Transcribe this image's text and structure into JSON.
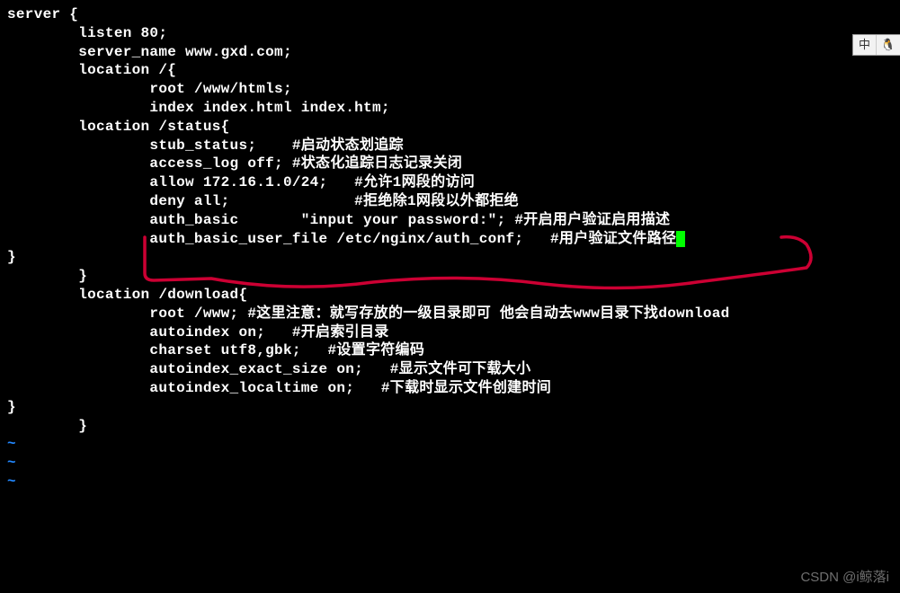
{
  "code": {
    "l0": "server {",
    "l1": "        listen 80;",
    "l2": "        server_name www.gxd.com;",
    "l3": "",
    "l4": "        location /{",
    "l5": "                root /www/htmls;",
    "l6": "                index index.html index.htm;",
    "l7": "        location /status{",
    "l8": "                stub_status;    #启动状态划追踪",
    "l9": "                access_log off; #状态化追踪日志记录关闭",
    "l10": "                allow 172.16.1.0/24;   #允许1网段的访问",
    "l11": "                deny all;              #拒绝除1网段以外都拒绝",
    "l12": "                auth_basic       \"input your password:\"; #开启用户验证启用描述",
    "l13": "                auth_basic_user_file /etc/nginx/auth_conf;   #用户验证文件路径",
    "l14": "}",
    "l15": "        }",
    "l16": "        location /download{",
    "l17": "",
    "l18": "                root /www; #这里注意：就写存放的一级目录即可 他会自动去www目录下找download",
    "l19": "                autoindex on;   #开启索引目录",
    "l20": "                charset utf8,gbk;   #设置字符编码",
    "l21": "                autoindex_exact_size on;   #显示文件可下载大小",
    "l22": "                autoindex_localtime on;   #下载时显示文件创建时间",
    "l23": "",
    "l24": "",
    "l25": "}",
    "l26": "        }"
  },
  "tildes": [
    "~",
    "~",
    "~"
  ],
  "ime": {
    "left": "中",
    "right": "🐧"
  },
  "watermark": "CSDN @i鲸落i"
}
